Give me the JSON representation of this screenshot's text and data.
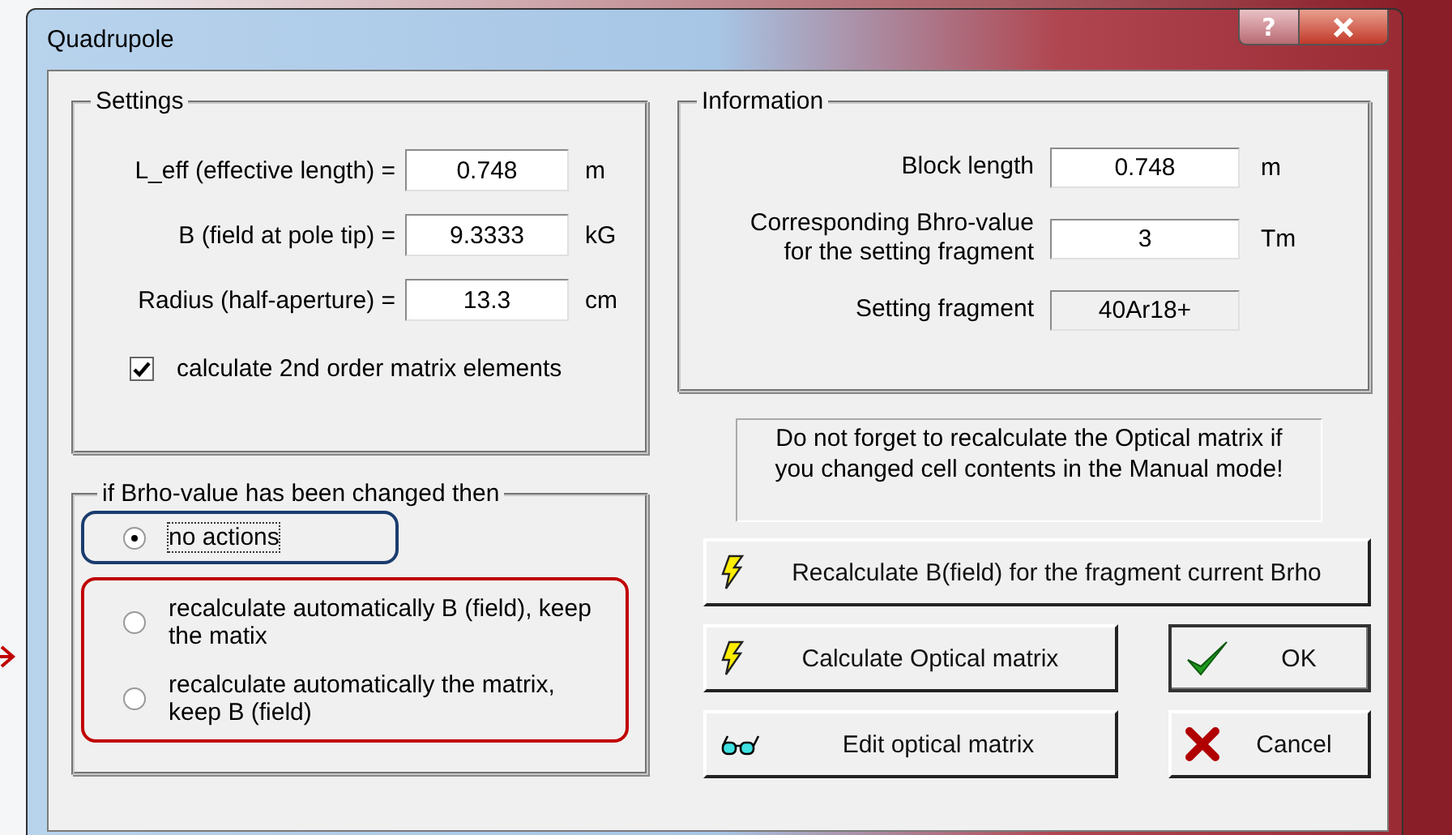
{
  "window": {
    "title": "Quadrupole",
    "help_button": "?"
  },
  "settings": {
    "title": "Settings",
    "fields": [
      {
        "label": "L_eff (effective length) =",
        "value": "0.748",
        "unit": "m"
      },
      {
        "label": "B (field at pole tip) =",
        "value": "9.3333",
        "unit": "kG"
      },
      {
        "label": "Radius (half-aperture) =",
        "value": "13.3",
        "unit": "cm"
      }
    ],
    "checkbox": {
      "label": "calculate 2nd order matrix elements",
      "checked": true
    }
  },
  "brho_group": {
    "title": "if Brho-value has been changed then",
    "callouts": [
      {
        "color": "#1a3c6e",
        "arrow": false,
        "options": [
          {
            "label": "no actions",
            "selected": true,
            "focused": true
          }
        ]
      },
      {
        "color": "#c00000",
        "arrow": true,
        "options": [
          {
            "label": "recalculate automatically B (field), keep the matix",
            "selected": false,
            "focused": false
          },
          {
            "label": "recalculate automatically the matrix, keep  B (field)",
            "selected": false,
            "focused": false
          }
        ]
      }
    ]
  },
  "information": {
    "title": "Information",
    "fields": [
      {
        "label": "Block length",
        "value": "0.748",
        "unit": "m",
        "readonly": false
      },
      {
        "label": "Corresponding Bhro-value for the setting fragment",
        "value": "3",
        "unit": "Tm",
        "readonly": false
      },
      {
        "label": "Setting fragment",
        "value": "40Ar18+",
        "readonly": true
      }
    ]
  },
  "note": "Do not forget to recalculate the Optical matrix if you changed cell contents in the Manual mode!",
  "buttons": [
    {
      "label": "Recalculate B(field) for the fragment current Brho",
      "kind": "lightning",
      "wide": true,
      "default": false
    },
    {
      "label": "Calculate Optical matrix",
      "kind": "lightning",
      "wide": false,
      "default": false
    },
    {
      "label": "OK",
      "kind": "check",
      "wide": false,
      "default": true
    },
    {
      "label": "Edit optical matrix",
      "kind": "glasses",
      "wide": false,
      "default": false
    },
    {
      "label": "Cancel",
      "kind": "cross",
      "wide": false,
      "default": false
    }
  ]
}
